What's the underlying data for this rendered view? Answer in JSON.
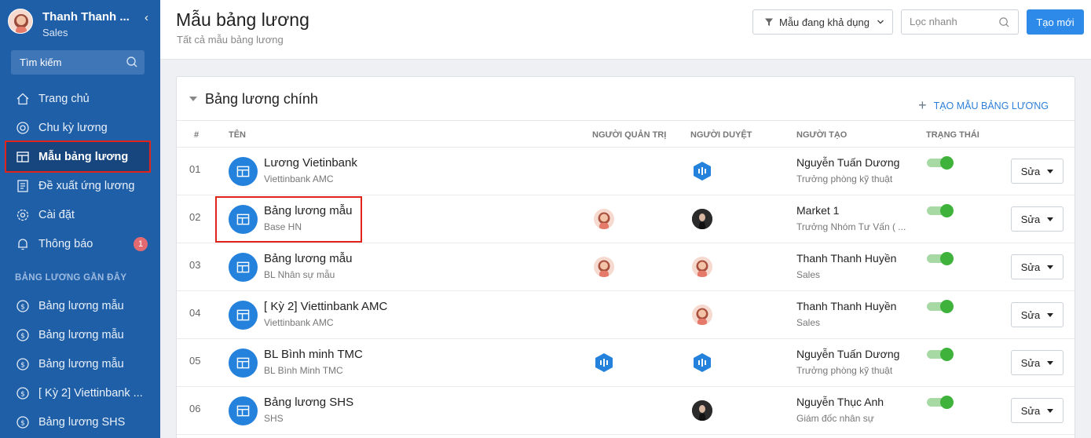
{
  "sidebar": {
    "user_name": "Thanh Thanh ...",
    "user_role": "Sales",
    "search_label": "Tìm kiếm",
    "nav": [
      {
        "label": "Trang chủ"
      },
      {
        "label": "Chu kỳ lương"
      },
      {
        "label": "Mẫu bảng lương"
      },
      {
        "label": "Đề xuất ứng lương"
      },
      {
        "label": "Cài đặt"
      },
      {
        "label": "Thông báo",
        "badge": "1"
      }
    ],
    "recent_title": "BẢNG LƯƠNG GẦN ĐÂY",
    "recent": [
      {
        "label": "Bảng lương mẫu"
      },
      {
        "label": "Bảng lương mẫu"
      },
      {
        "label": "Bảng lương mẫu"
      },
      {
        "label": "[ Kỳ 2] Viettinbank ..."
      },
      {
        "label": "Bảng lương SHS"
      }
    ]
  },
  "header": {
    "title": "Mẫu bảng lương",
    "subtitle": "Tất cả mẫu bảng lương",
    "filter_label": "Mẫu đang khả dụng",
    "quick_filter_placeholder": "Lọc nhanh",
    "create_label": "Tạo mới"
  },
  "card": {
    "title": "Bảng lương chính",
    "create_template_label": "TẠO MẪU BẢNG LƯƠNG",
    "columns": {
      "num": "#",
      "name": "TÊN",
      "admin": "NGƯỜI QUẢN TRỊ",
      "approver": "NGƯỜI DUYỆT",
      "creator": "NGƯỜI TẠO",
      "status": "TRẠNG THÁI"
    },
    "edit_label": "Sửa",
    "rows": [
      {
        "num": "01",
        "name": "Lương Vietinbank",
        "sub": "Viettinbank AMC",
        "admin": "",
        "approver": "hex",
        "creator": "Nguyễn Tuấn Dương",
        "creator_sub": "Trưởng phòng kỹ thuật",
        "active": true
      },
      {
        "num": "02",
        "name": "Bảng lương mẫu",
        "sub": "Base HN",
        "admin": "girl",
        "approver": "dark",
        "creator": "Market 1",
        "creator_sub": "Trưởng Nhóm Tư Vấn ( ...",
        "active": true
      },
      {
        "num": "03",
        "name": "Bảng lương mẫu",
        "sub": "BL Nhân sự mẫu",
        "admin": "girl",
        "approver": "girl",
        "creator": "Thanh Thanh Huyền",
        "creator_sub": "Sales",
        "active": true
      },
      {
        "num": "04",
        "name": "[ Kỳ 2] Viettinbank AMC",
        "sub": "Viettinbank AMC",
        "admin": "",
        "approver": "girl",
        "creator": "Thanh Thanh Huyền",
        "creator_sub": "Sales",
        "active": true
      },
      {
        "num": "05",
        "name": "BL Bình minh TMC",
        "sub": "BL Bình Minh TMC",
        "admin": "hex",
        "approver": "hex",
        "creator": "Nguyễn Tuấn Dương",
        "creator_sub": "Trưởng phòng kỹ thuật",
        "active": true
      },
      {
        "num": "06",
        "name": "Bảng lương SHS",
        "sub": "SHS",
        "admin": "",
        "approver": "dark",
        "creator": "Nguyễn Thục Anh",
        "creator_sub": "Giám đốc nhân sự",
        "active": true
      }
    ]
  }
}
